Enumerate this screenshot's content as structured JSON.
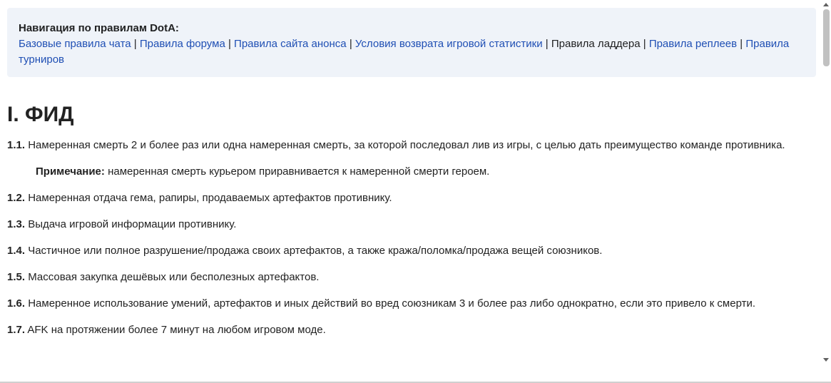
{
  "nav": {
    "title": "Навигация по правилам DotA:",
    "links": [
      {
        "label": "Базовые правила чата",
        "current": false
      },
      {
        "label": "Правила форума",
        "current": false
      },
      {
        "label": "Правила сайта анонса",
        "current": false
      },
      {
        "label": "Условия возврата игровой статистики",
        "current": false
      },
      {
        "label": "Правила ладдера",
        "current": true
      },
      {
        "label": "Правила реплеев",
        "current": false
      },
      {
        "label": "Правила турниров",
        "current": false
      }
    ],
    "separator": "|"
  },
  "section": {
    "title": "I. ФИД",
    "rules": [
      {
        "num": "1.1.",
        "text": "Намеренная смерть 2 и более раз или одна намеренная смерть, за которой последовал лив из игры, с целью дать преимущество команде противника."
      },
      {
        "num": "1.2.",
        "text": "Намеренная отдача гема, рапиры, продаваемых артефактов противнику."
      },
      {
        "num": "1.3.",
        "text": "Выдача игровой информации противнику."
      },
      {
        "num": "1.4.",
        "text": "Частичное или полное разрушение/продажа своих артефактов, а также кража/поломка/продажа вещей союзников."
      },
      {
        "num": "1.5.",
        "text": "Массовая закупка дешёвых или бесполезных артефактов."
      },
      {
        "num": "1.6.",
        "text": "Намеренное использование умений, артефактов и иных действий во вред союзникам 3 и более раз либо однократно, если это привело к смерти."
      },
      {
        "num": "1.7.",
        "text": "AFK на протяжении более 7 минут на любом игровом моде."
      }
    ],
    "note": {
      "label": "Примечание:",
      "text": "намеренная смерть курьером приравнивается к намеренной смерти героем."
    }
  }
}
